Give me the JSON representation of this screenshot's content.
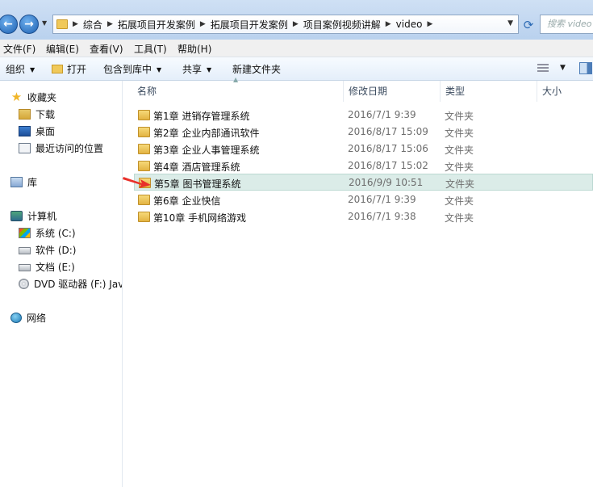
{
  "address": {
    "breadcrumbs": [
      "综合",
      "拓展项目开发案例",
      "拓展项目开发案例",
      "项目案例视频讲解",
      "video"
    ],
    "search_placeholder": "搜索 video"
  },
  "menu": [
    "文件(F)",
    "编辑(E)",
    "查看(V)",
    "工具(T)",
    "帮助(H)"
  ],
  "toolbar": {
    "organize": "组织",
    "open": "打开",
    "include_in_library": "包含到库中",
    "share": "共享",
    "new_folder": "新建文件夹"
  },
  "nav": {
    "favorites": "收藏夹",
    "downloads": "下载",
    "desktop": "桌面",
    "recent": "最近访问的位置",
    "libraries": "库",
    "computer": "计算机",
    "drive_c": "系统 (C:)",
    "drive_d": "软件 (D:)",
    "drive_e": "文档 (E:)",
    "drive_f": "DVD 驱动器 (F:) Java",
    "network": "网络"
  },
  "columns": {
    "name": "名称",
    "modified": "修改日期",
    "type": "类型",
    "size": "大小"
  },
  "files": [
    {
      "name": "第1章 进销存管理系统",
      "modified": "2016/7/1 9:39",
      "type": "文件夹"
    },
    {
      "name": "第2章 企业内部通讯软件",
      "modified": "2016/8/17 15:09",
      "type": "文件夹"
    },
    {
      "name": "第3章 企业人事管理系统",
      "modified": "2016/8/17 15:06",
      "type": "文件夹"
    },
    {
      "name": "第4章 酒店管理系统",
      "modified": "2016/8/17 15:02",
      "type": "文件夹"
    },
    {
      "name": "第5章 图书管理系统",
      "modified": "2016/9/9 10:51",
      "type": "文件夹"
    },
    {
      "name": "第6章 企业快信",
      "modified": "2016/7/1 9:39",
      "type": "文件夹"
    },
    {
      "name": "第10章 手机网络游戏",
      "modified": "2016/7/1 9:38",
      "type": "文件夹"
    }
  ],
  "colors": {
    "selection": "#dbece8",
    "annotation_arrow": "#e8302a"
  }
}
